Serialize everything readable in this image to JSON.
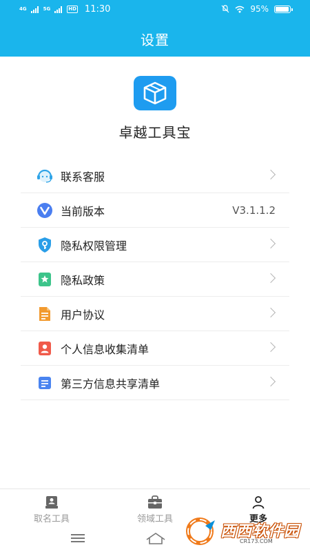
{
  "status_bar": {
    "net1": "4G",
    "net2": "5G",
    "hd": "HD",
    "time": "11:30",
    "battery_text": "95%",
    "battery_level": 0.95
  },
  "header": {
    "title": "设置"
  },
  "app": {
    "name": "卓越工具宝"
  },
  "menu": {
    "items": [
      {
        "label": "联系客服",
        "icon": "customer-service-icon",
        "color": "#2fa4e7"
      },
      {
        "label": "当前版本",
        "icon": "version-icon",
        "color": "#4a7ef0",
        "value": "V3.1.1.2"
      },
      {
        "label": "隐私权限管理",
        "icon": "shield-key-icon",
        "color": "#2a9ee8"
      },
      {
        "label": "隐私政策",
        "icon": "policy-icon",
        "color": "#3cc48a"
      },
      {
        "label": "用户协议",
        "icon": "document-icon",
        "color": "#f29a2e"
      },
      {
        "label": "个人信息收集清单",
        "icon": "person-icon",
        "color": "#f05a4a"
      },
      {
        "label": "第三方信息共享清单",
        "icon": "list-icon",
        "color": "#4a84f0"
      }
    ]
  },
  "tabbar": {
    "tabs": [
      {
        "label": "取名工具",
        "icon": "naming-tool-icon"
      },
      {
        "label": "领域工具",
        "icon": "briefcase-icon"
      },
      {
        "label": "更多",
        "icon": "person-outline-icon",
        "active": true
      }
    ]
  },
  "watermark": {
    "text": "西西软件园",
    "sub": "CR173.COM"
  }
}
